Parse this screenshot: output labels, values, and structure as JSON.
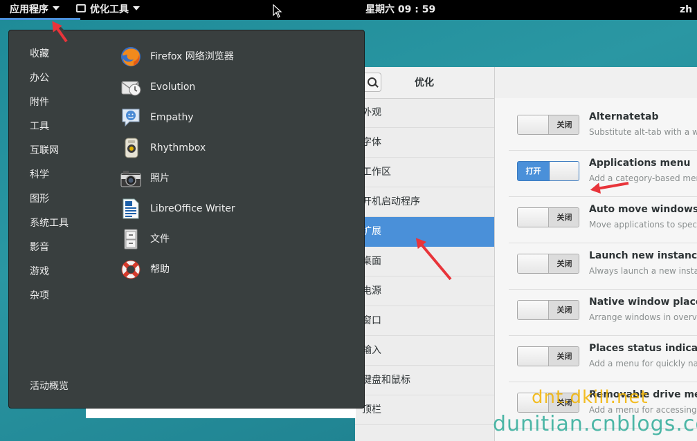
{
  "topbar": {
    "apps_label": "应用程序",
    "tweak_label": "优化工具",
    "clock": "星期六 09 : 59",
    "lang": "zh"
  },
  "apps_menu": {
    "categories": [
      "收藏",
      "办公",
      "附件",
      "工具",
      "互联网",
      "科学",
      "图形",
      "系统工具",
      "影音",
      "游戏",
      "杂项"
    ],
    "overview_label": "活动概览",
    "apps": [
      {
        "label": "Firefox 网络浏览器",
        "icon": "firefox-icon"
      },
      {
        "label": "Evolution",
        "icon": "evolution-icon"
      },
      {
        "label": "Empathy",
        "icon": "empathy-icon"
      },
      {
        "label": "Rhythmbox",
        "icon": "rhythmbox-icon"
      },
      {
        "label": "照片",
        "icon": "camera-icon"
      },
      {
        "label": "LibreOffice Writer",
        "icon": "writer-icon"
      },
      {
        "label": "文件",
        "icon": "files-icon"
      },
      {
        "label": "帮助",
        "icon": "help-lifebuoy-icon"
      }
    ]
  },
  "tweak": {
    "title": "优化",
    "categories": [
      "外观",
      "字体",
      "工作区",
      "开机启动程序",
      "扩展",
      "桌面",
      "电源",
      "窗口",
      "输入",
      "键盘和鼠标",
      "顶栏"
    ],
    "selected_category": "扩展",
    "switch_off_label": "关闭",
    "switch_on_label": "打开",
    "extensions": [
      {
        "name": "Alternatetab",
        "desc": "Substitute alt-tab with a wi",
        "enabled": false
      },
      {
        "name": "Applications menu",
        "desc": "Add a category-based menu",
        "enabled": true
      },
      {
        "name": "Auto move windows",
        "desc": "Move applications to specif",
        "enabled": false
      },
      {
        "name": "Launch new instance",
        "desc": "Always launch a new instanc",
        "enabled": false
      },
      {
        "name": "Native window placer",
        "desc": "Arrange windows in overvie",
        "enabled": false
      },
      {
        "name": "Places status indicato",
        "desc": "Add a menu for quickly navi",
        "enabled": false
      },
      {
        "name": "Removable drive men",
        "desc": "Add a menu for accessing r",
        "enabled": false
      }
    ]
  },
  "watermarks": [
    "dnt.dkill.net",
    "dunitian.cnblogs.com"
  ],
  "colors": {
    "accent": "#4a90d9",
    "menu_bg": "#393f3f",
    "annotation": "#e8343a"
  }
}
